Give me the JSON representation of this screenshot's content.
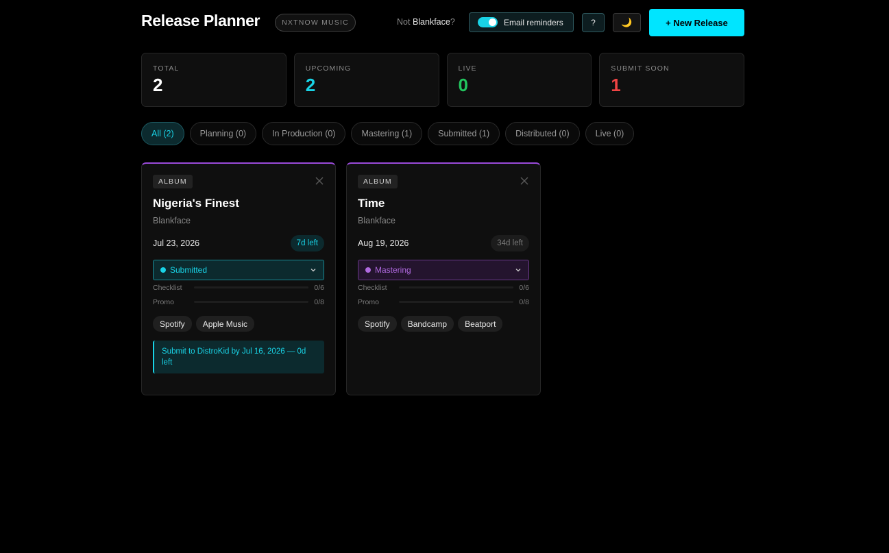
{
  "header": {
    "title": "Release Planner",
    "brand_badge": "NXTNOW MUSIC",
    "not_prefix": "Not ",
    "username": "Blankface",
    "not_suffix": "?",
    "reminder_label": "Email reminders",
    "reminder_enabled": true,
    "help_label": "?",
    "theme_icon": "moon-icon",
    "theme_glyph": "🌙",
    "new_release_label": "+ New Release"
  },
  "stats": [
    {
      "label": "TOTAL",
      "value": "2",
      "color": "#ffffff"
    },
    {
      "label": "UPCOMING",
      "value": "2",
      "color": "#19d3e6"
    },
    {
      "label": "LIVE",
      "value": "0",
      "color": "#22c55e"
    },
    {
      "label": "SUBMIT SOON",
      "value": "1",
      "color": "#ef4444"
    }
  ],
  "filters": [
    {
      "label": "All (2)",
      "active": true
    },
    {
      "label": "Planning (0)",
      "active": false
    },
    {
      "label": "In Production (0)",
      "active": false
    },
    {
      "label": "Mastering (1)",
      "active": false
    },
    {
      "label": "Submitted (1)",
      "active": false
    },
    {
      "label": "Distributed (0)",
      "active": false
    },
    {
      "label": "Live (0)",
      "active": false
    }
  ],
  "releases": [
    {
      "type": "ALBUM",
      "title": "Nigeria's Finest",
      "artist": "Blankface",
      "date": "Jul 23, 2026",
      "days_left": "7d left",
      "days_style": "urgent",
      "status": "Submitted",
      "status_style": "submitted",
      "checklist_label": "Checklist",
      "checklist": "0/6",
      "checklist_progress": 0,
      "promo_label": "Promo",
      "promo": "0/8",
      "promo_progress": 0,
      "platforms": [
        "Spotify",
        "Apple Music"
      ],
      "notice": "Submit to DistroKid by Jul 16, 2026 — 0d left"
    },
    {
      "type": "ALBUM",
      "title": "Time",
      "artist": "Blankface",
      "date": "Aug 19, 2026",
      "days_left": "34d left",
      "days_style": "normal",
      "status": "Mastering",
      "status_style": "mastering",
      "checklist_label": "Checklist",
      "checklist": "0/6",
      "checklist_progress": 0,
      "promo_label": "Promo",
      "promo": "0/8",
      "promo_progress": 0,
      "platforms": [
        "Spotify",
        "Bandcamp",
        "Beatport"
      ],
      "notice": ""
    }
  ],
  "colors": {
    "accent": "#00e5ff",
    "card_top_border": "#9b4bdb"
  }
}
